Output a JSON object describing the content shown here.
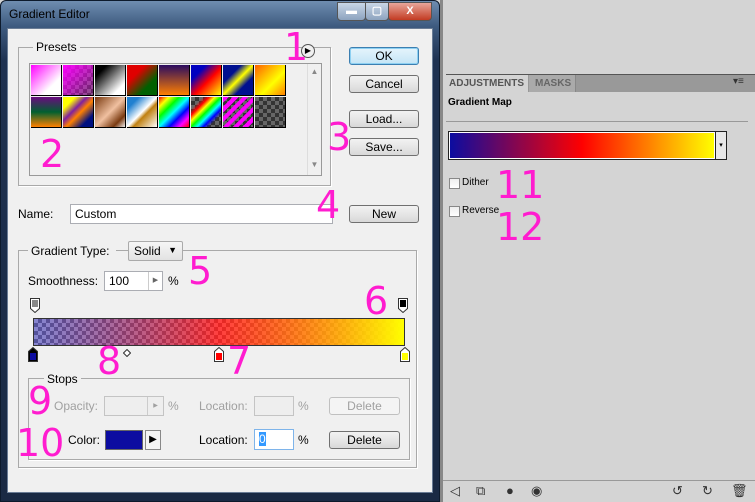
{
  "dialog": {
    "title": "Gradient Editor",
    "window_buttons": {
      "minimize": "▬",
      "maximize": "▢",
      "close": "X"
    }
  },
  "presets": {
    "label": "Presets"
  },
  "buttons": {
    "ok": "OK",
    "cancel": "Cancel",
    "load": "Load...",
    "save": "Save...",
    "new": "New"
  },
  "name": {
    "label": "Name:",
    "value": "Custom"
  },
  "gradient_type": {
    "label": "Gradient Type:",
    "value": "Solid"
  },
  "smoothness": {
    "label": "Smoothness:",
    "value": "100",
    "unit": "%"
  },
  "stops": {
    "label": "Stops",
    "opacity_label": "Opacity:",
    "opacity_unit": "%",
    "location_label": "Location:",
    "location_unit": "%",
    "delete": "Delete",
    "color_label": "Color:",
    "color_value": "#0c0ca0",
    "color_location": "0"
  },
  "gradient": {
    "colors": [
      "#0c0ca0",
      "#ff0000",
      "#ffff00"
    ],
    "color_stop_locations": [
      0,
      50,
      100
    ],
    "midpoint": 25
  },
  "annotations": [
    "1",
    "2",
    "3",
    "4",
    "5",
    "6",
    "7",
    "8",
    "9",
    "10",
    "11",
    "12"
  ],
  "panel": {
    "tabs": [
      "ADJUSTMENTS",
      "MASKS"
    ],
    "menu_icon": "▾≡",
    "title": "Gradient Map",
    "dither": "Dither",
    "reverse": "Reverse",
    "dropdown_icon": "▾"
  },
  "panel_footer": {
    "icons": [
      "back-arrow-icon",
      "clip-layer-icon",
      "visibility-state-icon",
      "eye-icon",
      "reset-previous-icon",
      "reset-icon",
      "trash-icon"
    ]
  }
}
